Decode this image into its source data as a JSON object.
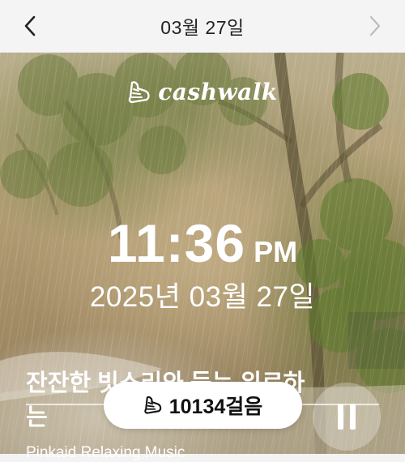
{
  "header": {
    "date_title": "03월 27일",
    "back_icon": "chevron-left-icon",
    "next_icon": "chevron-right-icon"
  },
  "logo": {
    "text": "cashwalk",
    "icon": "shoe-icon"
  },
  "clock": {
    "time": "11:36",
    "ampm": "PM",
    "full_date": "2025년 03월 27일"
  },
  "music": {
    "title": "잔잔한 빗소리와 듣는 위로하는",
    "artist": "Pinkaid Relaxing Music",
    "pause_icon": "pause-icon"
  },
  "steps": {
    "label": "10134걸음",
    "icon": "shoe-icon"
  },
  "colors": {
    "text_white": "#ffffff",
    "pill_bg": "#ffffff",
    "disabled": "#bdbdbd"
  }
}
